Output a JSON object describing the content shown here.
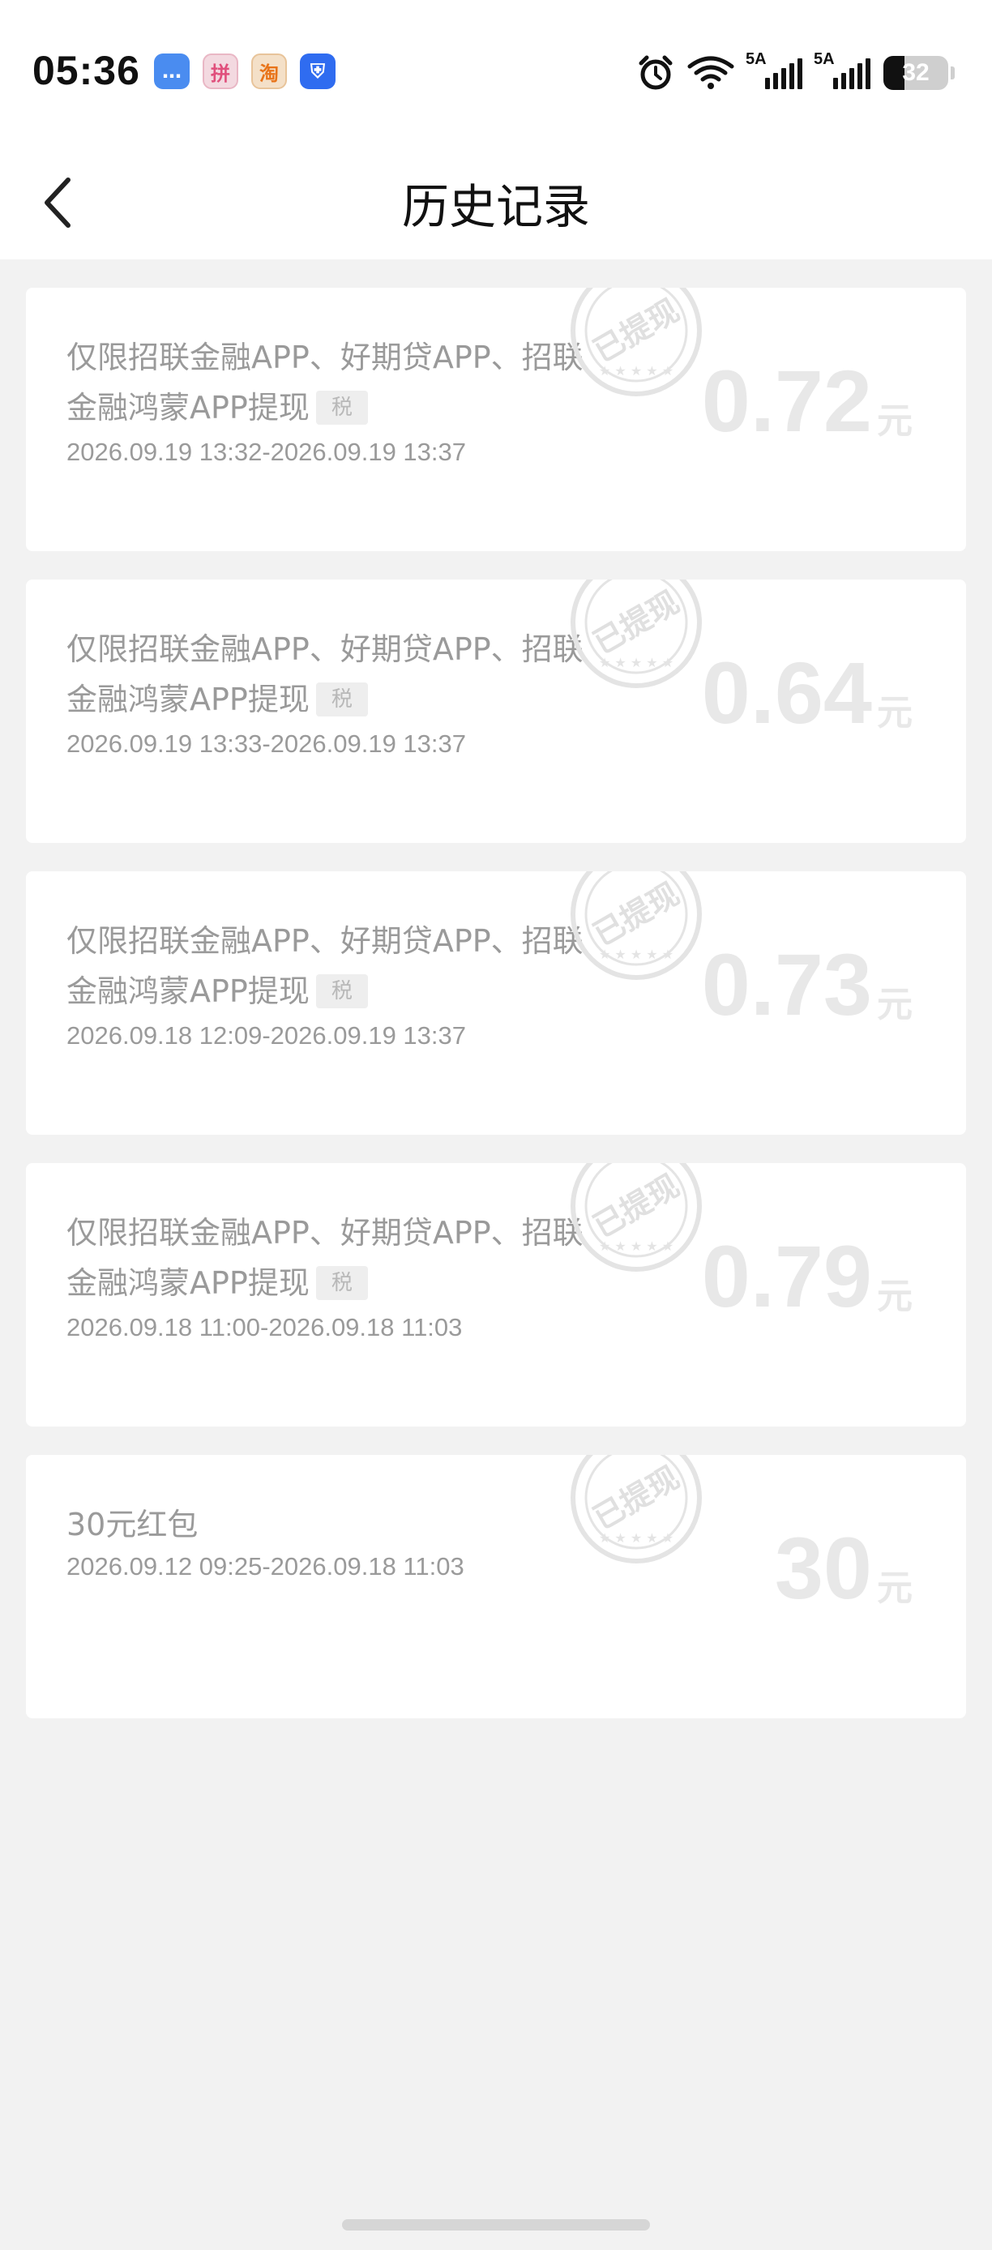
{
  "status": {
    "time": "05:36",
    "notifications": [
      {
        "name": "message-app-icon",
        "glyph": "…"
      },
      {
        "name": "pinduoduo-app-icon",
        "glyph": "拼"
      },
      {
        "name": "taobao-app-icon",
        "glyph": "淘"
      },
      {
        "name": "security-app-icon",
        "glyph": "⛨"
      }
    ],
    "signal1_label": "5A",
    "signal2_label": "5A",
    "battery_percent": "32",
    "battery_level": 0.32
  },
  "header": {
    "title": "历史记录"
  },
  "stamp_text": "已提现",
  "records": [
    {
      "desc": "仅限招联金融APP、好期贷APP、招联金融鸿蒙APP提现",
      "tax": "税",
      "period": "2026.09.19 13:32-2026.09.19 13:37",
      "amount": "0.72",
      "unit": "元"
    },
    {
      "desc": "仅限招联金融APP、好期贷APP、招联金融鸿蒙APP提现",
      "tax": "税",
      "period": "2026.09.19 13:33-2026.09.19 13:37",
      "amount": "0.64",
      "unit": "元"
    },
    {
      "desc": "仅限招联金融APP、好期贷APP、招联金融鸿蒙APP提现",
      "tax": "税",
      "period": "2026.09.18 12:09-2026.09.19 13:37",
      "amount": "0.73",
      "unit": "元"
    },
    {
      "desc": "仅限招联金融APP、好期贷APP、招联金融鸿蒙APP提现",
      "tax": "税",
      "period": "2026.09.18 11:00-2026.09.18 11:03",
      "amount": "0.79",
      "unit": "元"
    },
    {
      "desc": "30元红包",
      "tax": "",
      "period": "2026.09.12 09:25-2026.09.18 11:03",
      "amount": "30",
      "unit": "元"
    }
  ]
}
